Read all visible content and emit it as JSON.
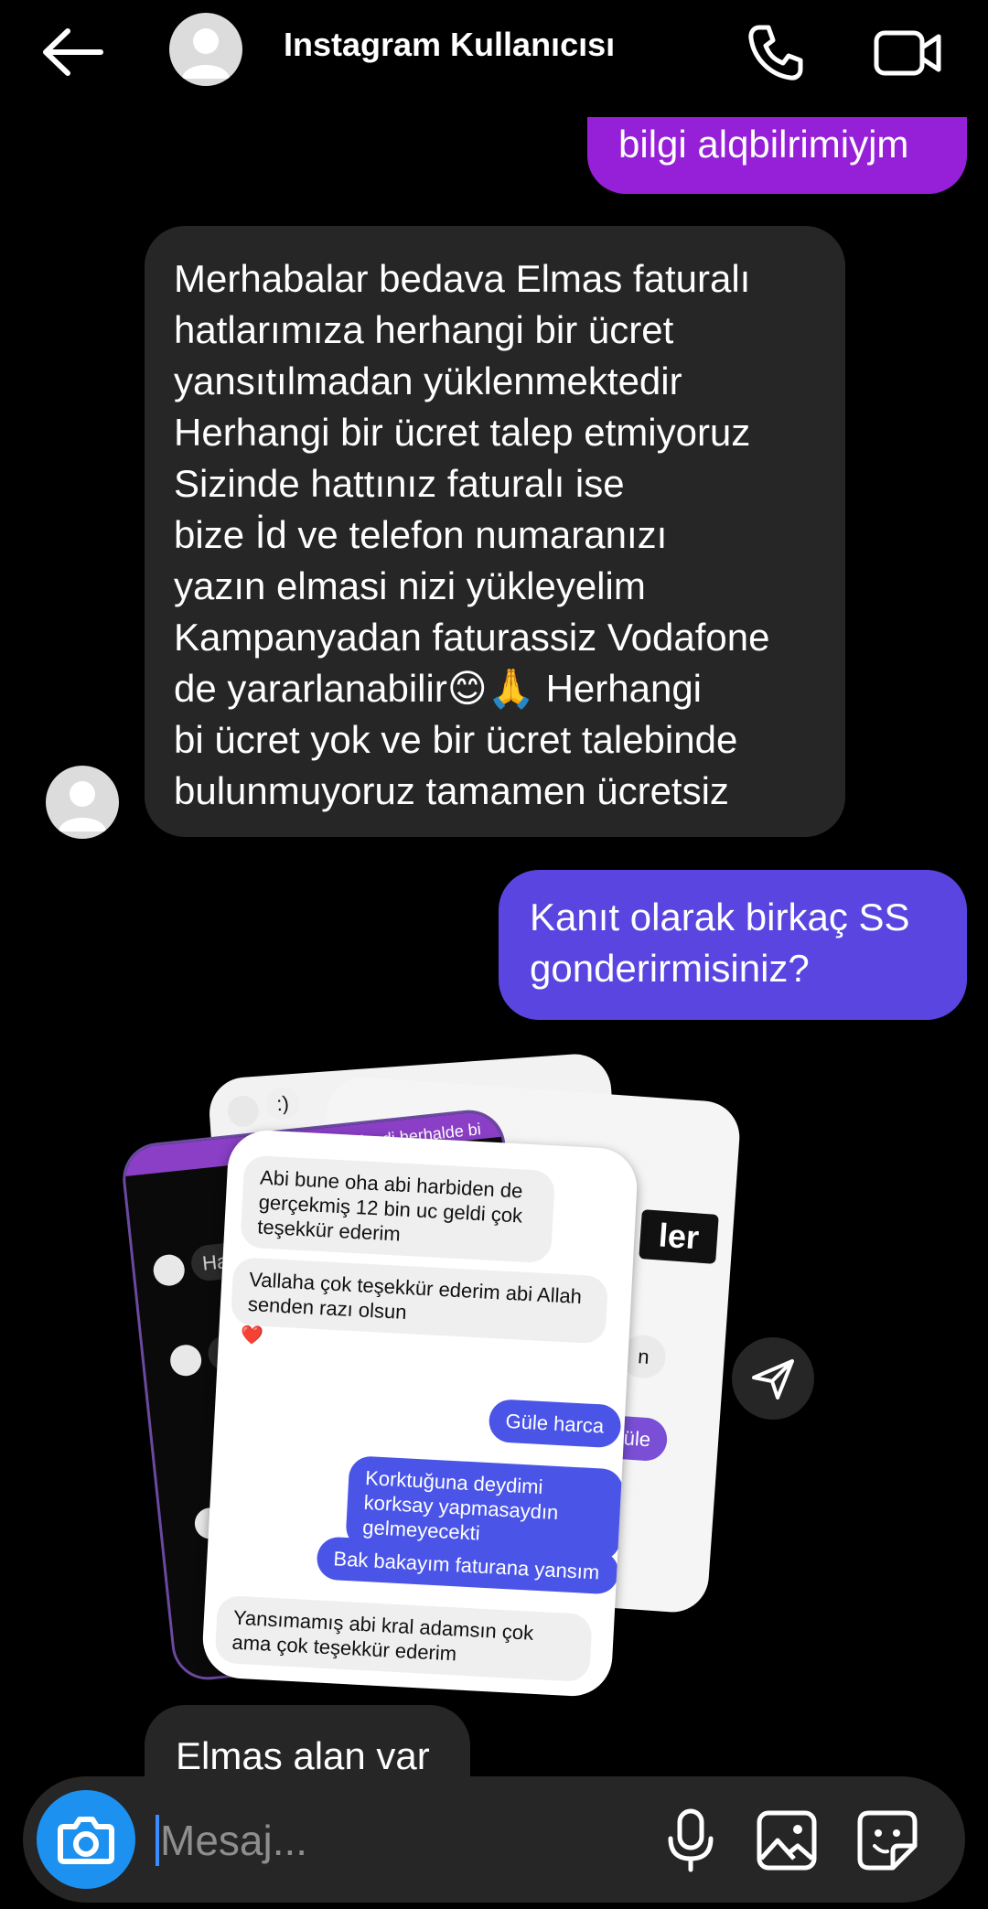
{
  "header": {
    "title": "Instagram Kullanıcısı",
    "icons": [
      "back-arrow-icon",
      "avatar",
      "phone-icon",
      "video-camera-icon"
    ]
  },
  "messages": [
    {
      "direction": "outgoing",
      "text": "bilgi alqbilrimiyjm"
    },
    {
      "direction": "incoming",
      "lines": [
        "Merhabalar bedava Elmas faturalı",
        "hatlarımıza herhangi bir ücret",
        "yansıtılmadan yüklenmektedir",
        "Herhangi bir ücret talep etmiyoruz",
        "Sizinde hattınız faturalı ise",
        "bize İd ve telefon numaranızı",
        "yazın elmasi nizi yükleyelim",
        "Kampanyadan faturassiz Vodafone",
        "de yararlanabilir😊🙏 Herhangi",
        "bi ücret yok ve bir ücret talebinde",
        "bulunmuyoruz tamamen ücretsiz"
      ]
    },
    {
      "direction": "outgoing",
      "lines": [
        "Kanıt olarak birkaç SS",
        "gonderirmisiniz?"
      ]
    },
    {
      "direction": "incoming",
      "text": "Elmas alan var"
    }
  ],
  "shared_media": {
    "front_card": [
      {
        "style": "grey",
        "text": "Abi bune oha abi harbiden de gerçekmiş 12 bin uc geldi çok teşekkür ederim"
      },
      {
        "style": "grey",
        "text": "Vallaha çok teşekkür ederim abi Allah senden razı olsun"
      },
      {
        "style": "reaction",
        "text": "❤️"
      },
      {
        "style": "blue",
        "text": "Güle harca"
      },
      {
        "style": "blue",
        "text": "Korktuğuna deydimi korksay yapmasaydın gelmeyecekti"
      },
      {
        "style": "blue",
        "text": "Bak bakayım faturana yansım"
      },
      {
        "style": "grey",
        "text": "Yansımamış abi kral adamsın çok ama çok teşekkür ederim"
      }
    ],
    "back_card_snippets": [
      ":)",
      "ler",
      "e güle",
      "Ham",
      "Re",
      "n",
      "lendi herhalde bi"
    ]
  },
  "composer": {
    "placeholder": "Mesaj...",
    "icons": [
      "camera-icon",
      "microphone-icon",
      "gallery-icon",
      "sticker-icon"
    ]
  },
  "colors": {
    "background": "#000000",
    "incoming_bubble": "#262626",
    "outgoing_purple": "#9620d7",
    "outgoing_indigo": "#5a45e0",
    "camera_button": "#1d91f0"
  }
}
